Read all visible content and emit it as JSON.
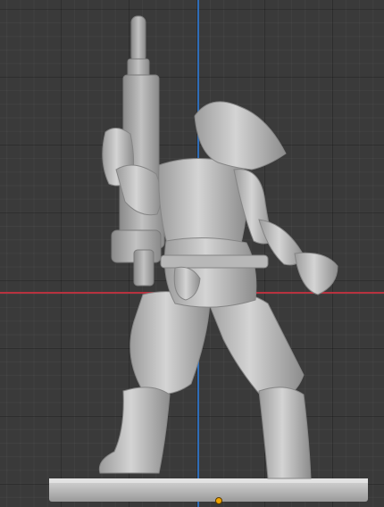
{
  "viewport": {
    "grid_color": "#2b2b2b",
    "background_color": "#3a3a3a",
    "axis_colors": {
      "x": "#b8323f",
      "y": "#2f6db8"
    },
    "model_color": "#c9c9c9",
    "origin_marker_color": "#f0a500",
    "model_name": "miniature-soldier-with-rifle"
  }
}
